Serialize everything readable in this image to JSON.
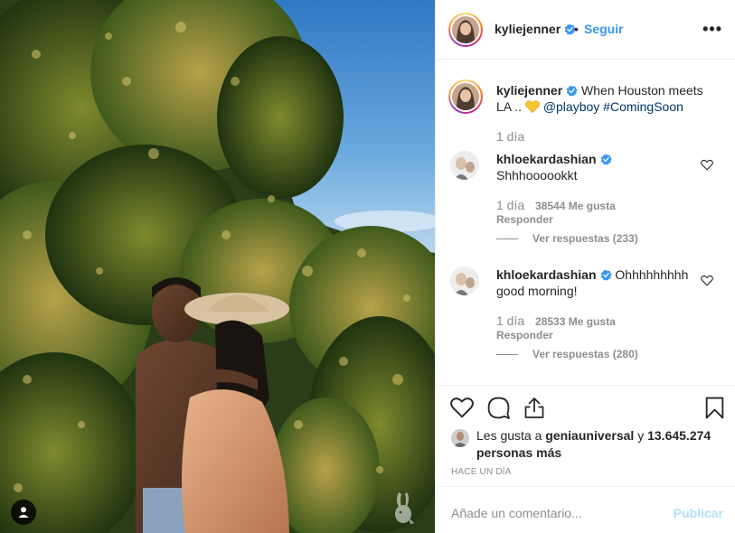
{
  "post": {
    "username": "kyliejenner",
    "dot": "•",
    "follow_label": "Seguir",
    "more_label": "•••",
    "user_tag_icon": "user-tag-icon",
    "watermark_icon": "playboy-bunny-logo"
  },
  "caption": {
    "username": "kyliejenner",
    "text": "When Houston meets LA ..",
    "emoji": "yellow-heart-icon",
    "mention": "@playboy",
    "hashtag": "#ComingSoon",
    "time": "1 día"
  },
  "comments": [
    {
      "username": "khloekardashian",
      "text": "Shhhoooookkt",
      "time": "1 día",
      "likes": "38544 Me gusta",
      "reply": "Responder",
      "view_replies": "Ver respuestas (233)"
    },
    {
      "username": "khloekardashian",
      "text": "Ohhhhhhhhh good morning!",
      "time": "1 día",
      "likes": "28533 Me gusta",
      "reply": "Responder",
      "view_replies": "Ver respuestas (280)"
    }
  ],
  "likes": {
    "prefix": "Les gusta a",
    "user": "geniauniversal",
    "joiner": "y",
    "others": "13.645.274 personas más"
  },
  "date": "HACE UN DÍA",
  "add_comment": {
    "placeholder": "Añade un comentario...",
    "publish": "Publicar"
  },
  "colors": {
    "link": "#003569",
    "follow": "#3897f0",
    "verified": "#3897f0",
    "muted": "#8e8e8e",
    "publish_disabled": "#b2dffc"
  }
}
